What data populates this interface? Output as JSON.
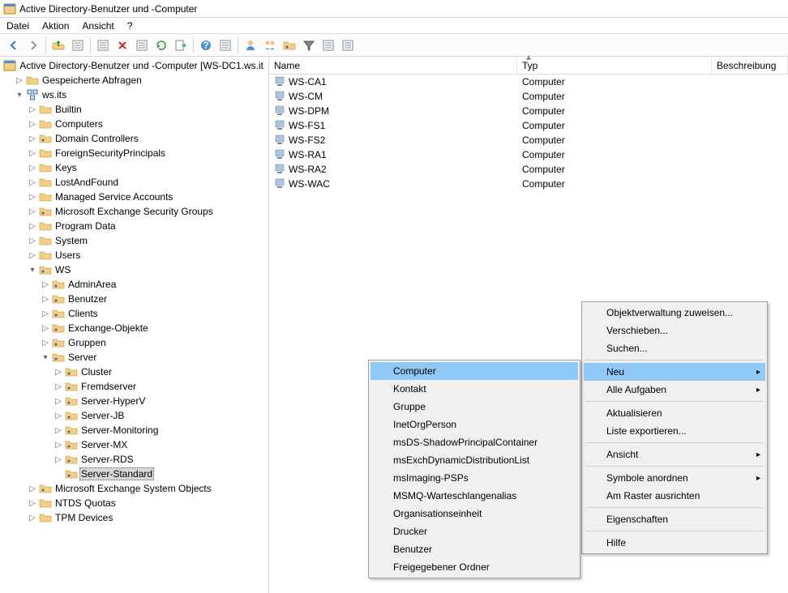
{
  "window_title": "Active Directory-Benutzer und -Computer",
  "menu": {
    "file": "Datei",
    "action": "Aktion",
    "view": "Ansicht",
    "help": "?"
  },
  "tree_root": "Active Directory-Benutzer und -Computer [WS-DC1.ws.it",
  "tree": {
    "saved_queries": "Gespeicherte Abfragen",
    "domain": "ws.its",
    "builtin": "Builtin",
    "computers": "Computers",
    "domain_controllers": "Domain Controllers",
    "fsp": "ForeignSecurityPrincipals",
    "keys": "Keys",
    "lostfound": "LostAndFound",
    "msa": "Managed Service Accounts",
    "mesg": "Microsoft Exchange Security Groups",
    "progdata": "Program Data",
    "system": "System",
    "users": "Users",
    "ws": "WS",
    "adminarea": "AdminArea",
    "benutzer": "Benutzer",
    "clients": "Clients",
    "exchobj": "Exchange-Objekte",
    "gruppen": "Gruppen",
    "server": "Server",
    "cluster": "Cluster",
    "fremd": "Fremdserver",
    "hyperv": "Server-HyperV",
    "jb": "Server-JB",
    "monitoring": "Server-Monitoring",
    "mx": "Server-MX",
    "rds": "Server-RDS",
    "standard": "Server-Standard",
    "meso": "Microsoft Exchange System Objects",
    "ntds": "NTDS Quotas",
    "tpm": "TPM Devices"
  },
  "columns": {
    "name": "Name",
    "type": "Typ",
    "desc": "Beschreibung"
  },
  "list": [
    {
      "name": "WS-CA1",
      "type": "Computer"
    },
    {
      "name": "WS-CM",
      "type": "Computer"
    },
    {
      "name": "WS-DPM",
      "type": "Computer"
    },
    {
      "name": "WS-FS1",
      "type": "Computer"
    },
    {
      "name": "WS-FS2",
      "type": "Computer"
    },
    {
      "name": "WS-RA1",
      "type": "Computer"
    },
    {
      "name": "WS-RA2",
      "type": "Computer"
    },
    {
      "name": "WS-WAC",
      "type": "Computer"
    }
  ],
  "context1": {
    "delegate": "Objektverwaltung zuweisen...",
    "move": "Verschieben...",
    "search": "Suchen...",
    "new": "Neu",
    "alltasks": "Alle Aufgaben",
    "refresh": "Aktualisieren",
    "export": "Liste exportieren...",
    "view": "Ansicht",
    "arrange": "Symbole anordnen",
    "grid": "Am Raster ausrichten",
    "properties": "Eigenschaften",
    "help": "Hilfe"
  },
  "context2": {
    "computer": "Computer",
    "contact": "Kontakt",
    "group": "Gruppe",
    "inetorg": "InetOrgPerson",
    "shadow": "msDS-ShadowPrincipalContainer",
    "exchdl": "msExchDynamicDistributionList",
    "imaging": "msImaging-PSPs",
    "msmq": "MSMQ-Warteschlangenalias",
    "ou": "Organisationseinheit",
    "printer": "Drucker",
    "user": "Benutzer",
    "share": "Freigegebener Ordner"
  }
}
